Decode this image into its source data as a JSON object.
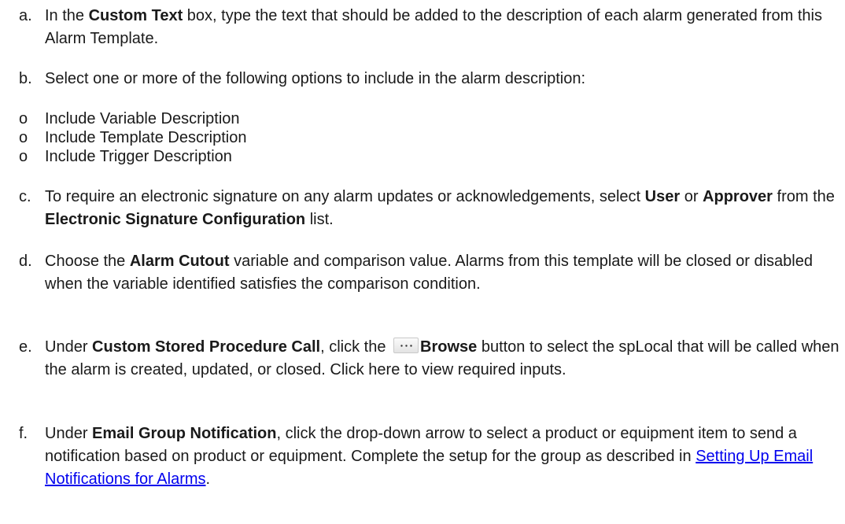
{
  "steps": {
    "a": {
      "marker": "a.",
      "t1": "In the ",
      "b1": "Custom Text",
      "t2": " box, type the text that should be added to the description of each alarm generated from this Alarm Template."
    },
    "b": {
      "marker": "b.",
      "t1": "Select one or more of the following options to include in the alarm description:"
    },
    "options": [
      {
        "marker": "o",
        "label": "Include Variable Description"
      },
      {
        "marker": "o",
        "label": "Include Template Description"
      },
      {
        "marker": "o",
        "label": "Include Trigger Description"
      }
    ],
    "c": {
      "marker": "c.",
      "t1": "To require an electronic signature on any alarm updates or acknowledgements, select ",
      "b1": "User",
      "t2": " or ",
      "b2": "Approver",
      "t3": " from the ",
      "b3": "Electronic Signature Configuration",
      "t4": " list."
    },
    "d": {
      "marker": "d.",
      "t1": "Choose the ",
      "b1": "Alarm Cutout",
      "t2": " variable and comparison value. Alarms from this template will be closed or disabled when the variable identified satisfies the comparison condition."
    },
    "e": {
      "marker": "e.",
      "t1": "Under ",
      "b1": "Custom Stored Procedure Call",
      "t2": ", click the ",
      "b2": "Browse",
      "t3": " button to select the spLocal that will be called when the alarm is created, updated, or closed. Click here to view required inputs."
    },
    "f": {
      "marker": "f.",
      "t1": "Under ",
      "b1": "Email Group Notification",
      "t2": ", click the drop-down arrow to select a product or equipment item to send a notification based on product or equipment. Complete the setup for the group as described in ",
      "link": "Setting Up Email Notifications for Alarms",
      "t3": "."
    }
  },
  "icons": {
    "browse": "ellipsis-icon"
  }
}
